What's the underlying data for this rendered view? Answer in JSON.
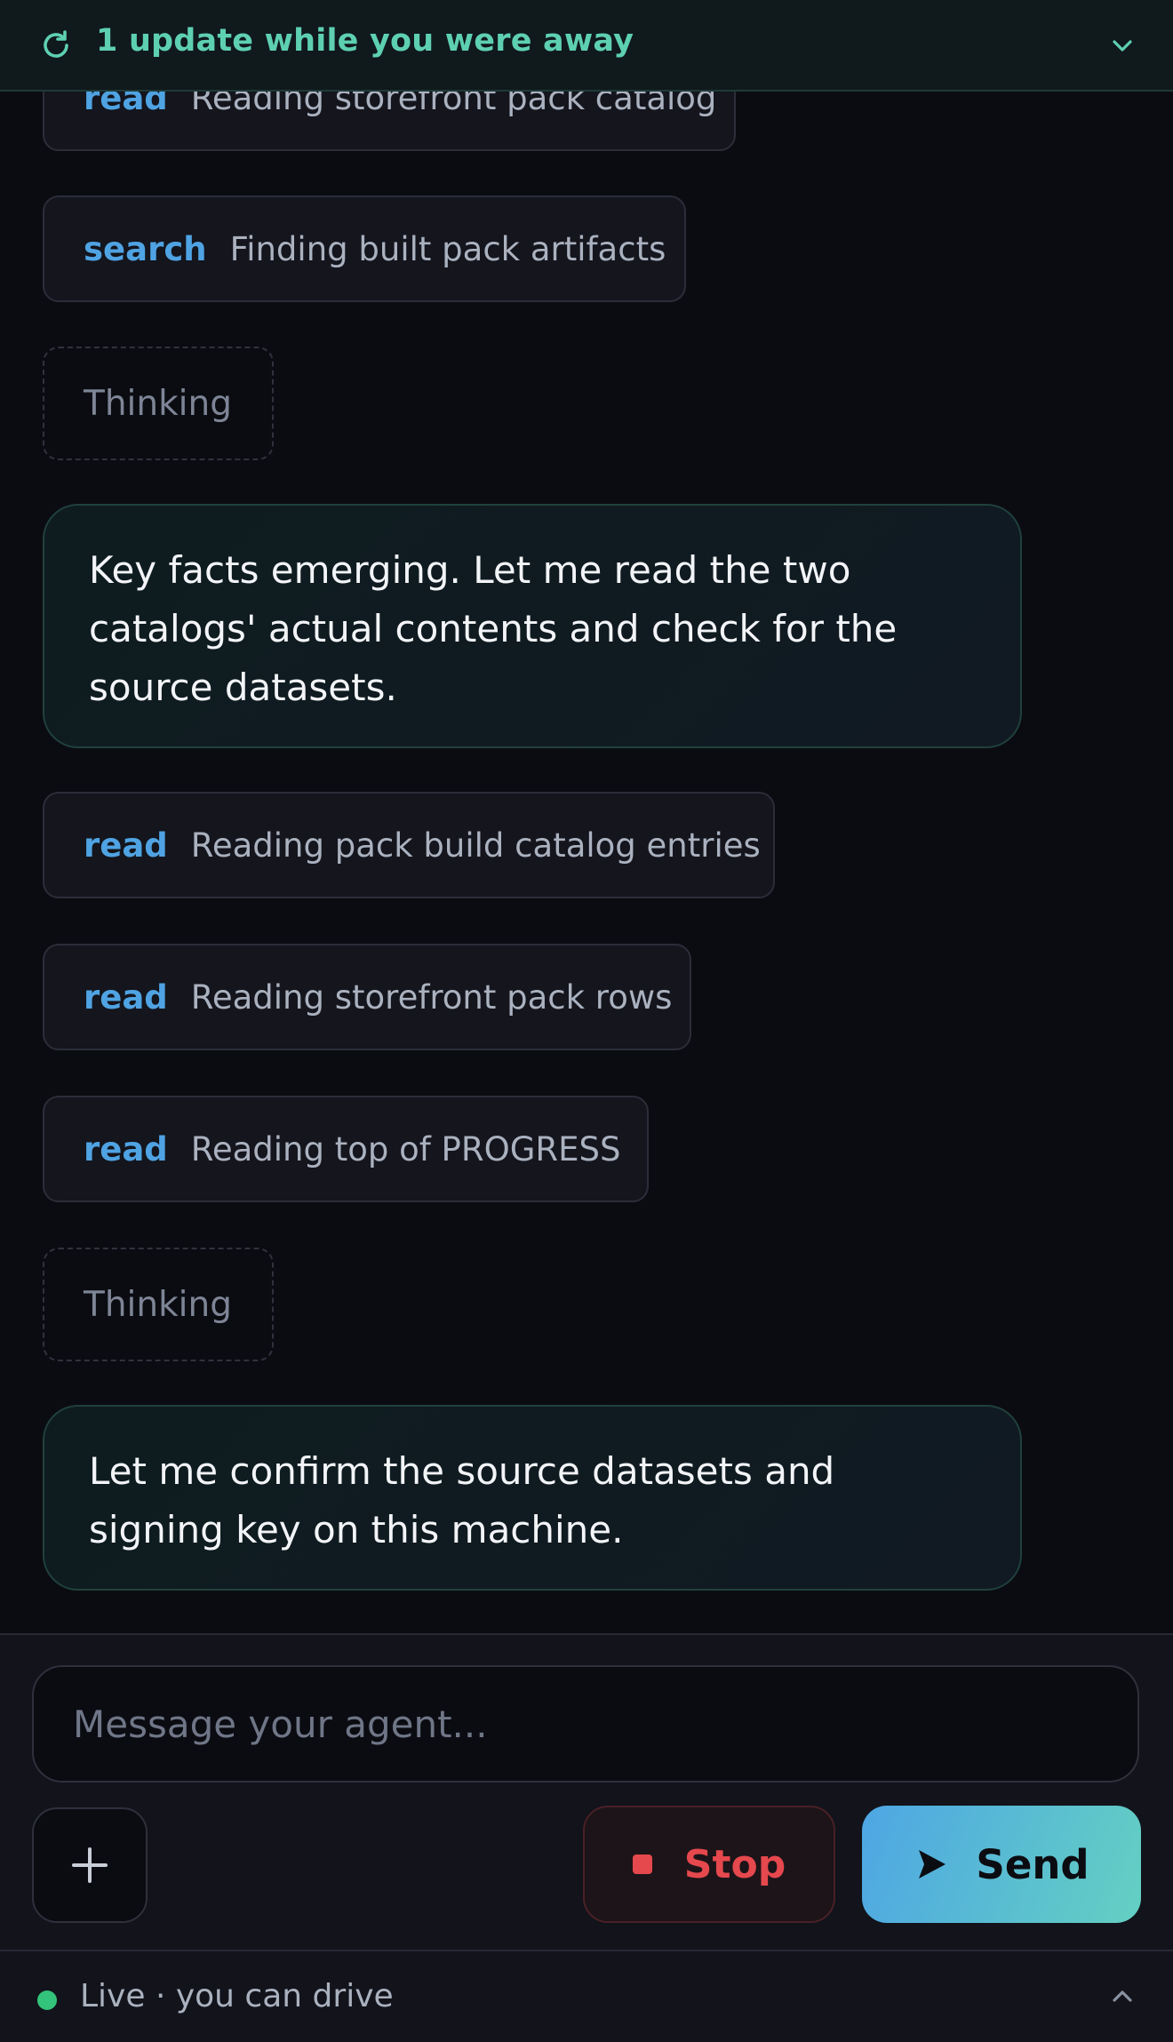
{
  "banner": {
    "text": "1 update while you were away",
    "icon": "refresh-icon",
    "toggle_icon": "chevron-down-icon",
    "accent": "#5ed0b2"
  },
  "feed": {
    "items": [
      {
        "kind": "tool",
        "verb": "read",
        "desc": "Reading storefront pack catalog"
      },
      {
        "kind": "tool",
        "verb": "search",
        "desc": "Finding built pack artifacts"
      },
      {
        "kind": "thinking",
        "text": "Thinking"
      },
      {
        "kind": "message",
        "text": "Key facts emerging. Let me read the two catalogs' actual contents and check for the source datasets."
      },
      {
        "kind": "tool",
        "verb": "read",
        "desc": "Reading pack build catalog entries"
      },
      {
        "kind": "tool",
        "verb": "read",
        "desc": "Reading storefront pack rows"
      },
      {
        "kind": "tool",
        "verb": "read",
        "desc": "Reading top of PROGRESS"
      },
      {
        "kind": "thinking",
        "text": "Thinking"
      },
      {
        "kind": "message",
        "text": "Let me confirm the source datasets and signing key on this machine."
      }
    ]
  },
  "composer": {
    "placeholder": "Message your agent...",
    "value": "",
    "add_icon": "plus-icon",
    "stop_label": "Stop",
    "send_label": "Send",
    "send_icon": "play-icon",
    "stop_color": "#e5484d"
  },
  "status": {
    "text": "Live · you can drive",
    "dot_color": "#34c37a",
    "toggle_icon": "chevron-up-icon"
  }
}
